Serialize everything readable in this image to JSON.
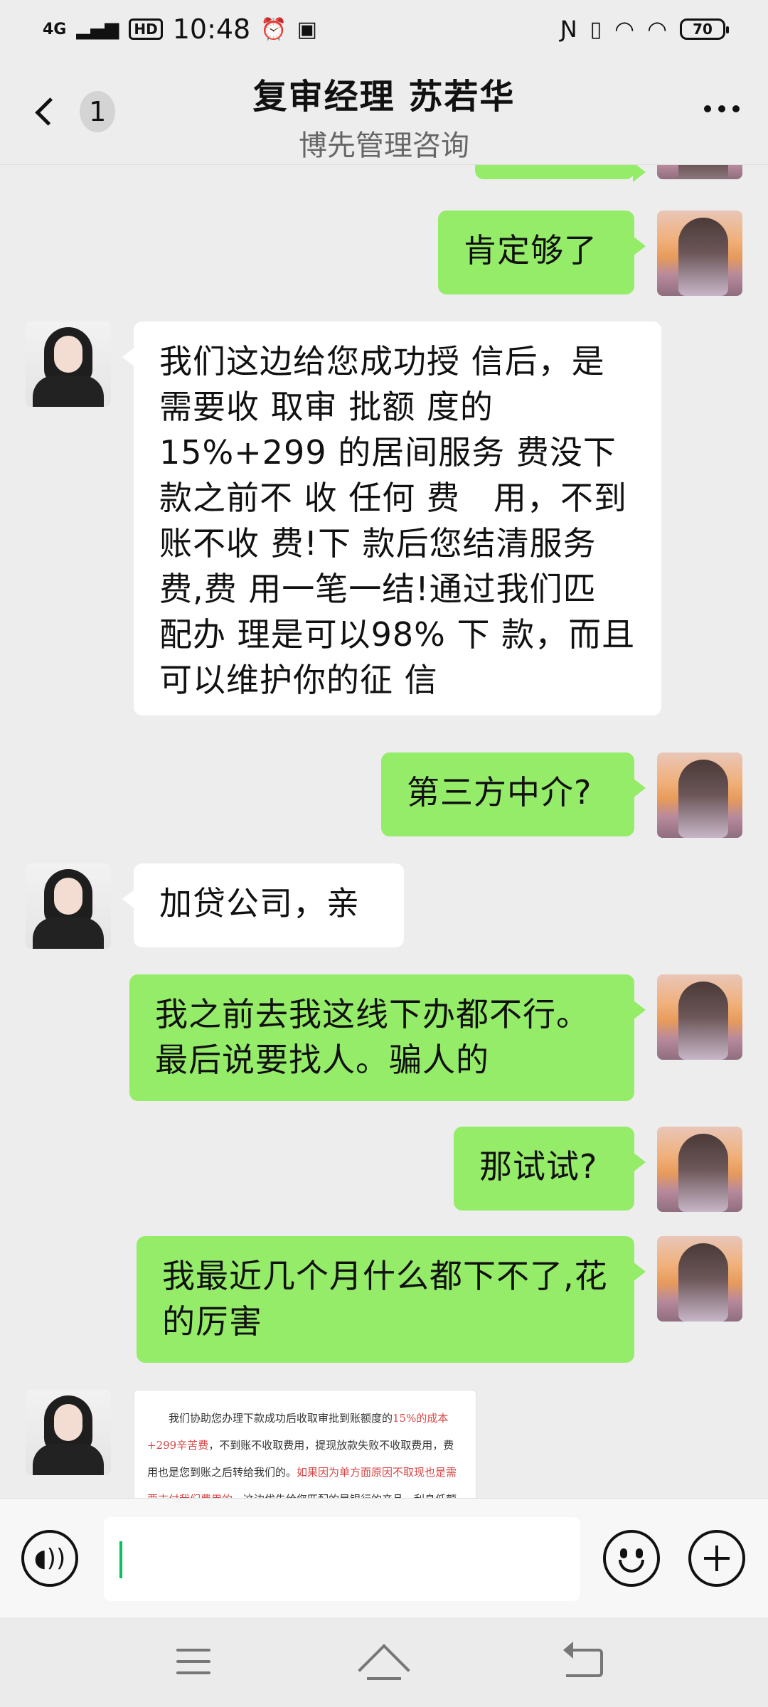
{
  "status_bar": {
    "network": "4G",
    "hd": "HD",
    "time": "10:48",
    "battery": "70",
    "icons": [
      "signal-icon",
      "alarm-icon",
      "chat-icon",
      "nfc-icon",
      "vibrate-icon",
      "wifi-icon"
    ]
  },
  "header": {
    "back_badge": "1",
    "title": "复审经理 苏若华",
    "subtitle": "博先管理咨询"
  },
  "messages": [
    {
      "side": "me",
      "text": ""
    },
    {
      "side": "me",
      "text": "肯定够了"
    },
    {
      "side": "them",
      "text": "我们这边给您成功授 信后，是需要收 取审 批额 度的15%+299 的居间服务 费没下 款之前不 收 任何 费　用，不到 账不收 费!下 款后您结清服务 费,费 用一笔一结!通过我们匹 配办 理是可以98% 下 款，而且可以维护你的征 信"
    },
    {
      "side": "me",
      "text": "第三方中介?"
    },
    {
      "side": "them",
      "text": "加贷公司，亲"
    },
    {
      "side": "me",
      "text": "我之前去我这线下办都不行。最后说要找人。骗人的"
    },
    {
      "side": "me",
      "text": "那试试?"
    },
    {
      "side": "me",
      "text": "我最近几个月什么都下不了,花的厉害"
    }
  ],
  "doc_preview": {
    "text_a": "　　我们协助您办理下款成功后收取审批到账额度的",
    "text_b": "15%的成本+299辛苦费",
    "text_c": "，不到账不收取费用，提现放款失败不收取费用，费用也是您到账之后转给我们的。",
    "text_d": "如果因为单方面原因不取现也是需要支付我们费用的",
    "text_e": "，这边优先给您匹配的是银行的产品，利息低额度"
  },
  "input_bar": {
    "value": ""
  },
  "colors": {
    "sent_bubble": "#95ec69",
    "received_bubble": "#ffffff",
    "background": "#ededed",
    "caret": "#07c160"
  }
}
